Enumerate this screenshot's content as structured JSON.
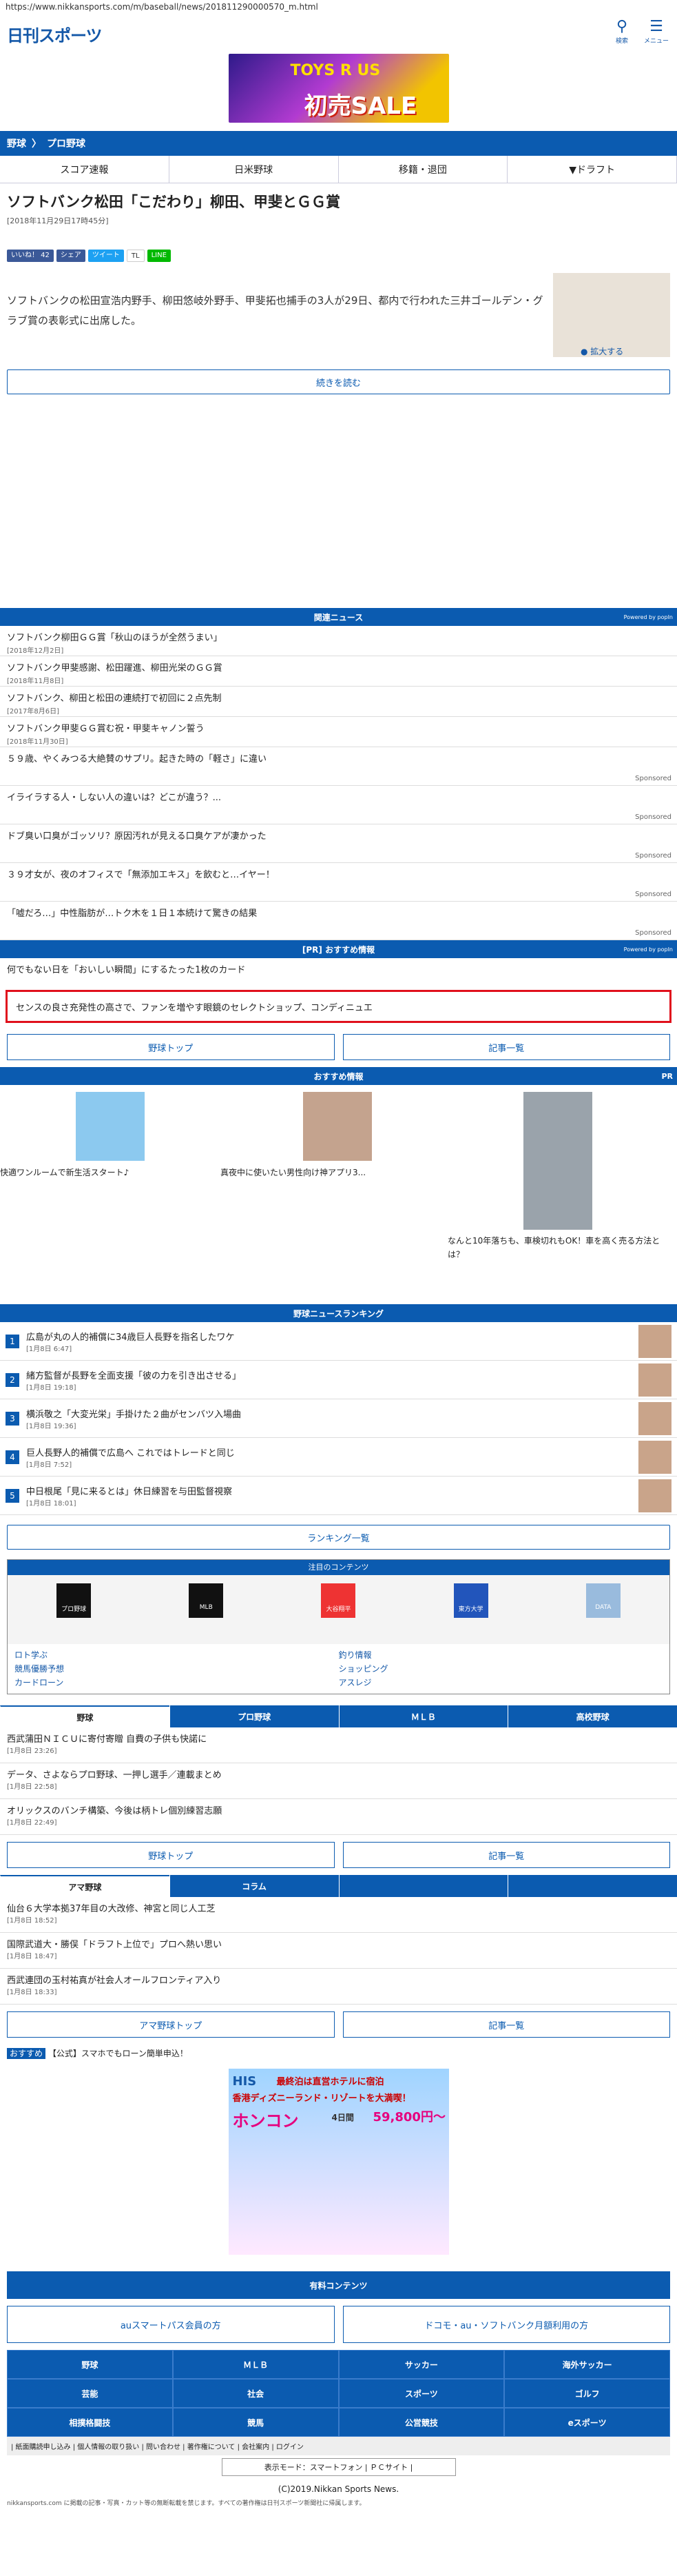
{
  "url": "https://www.nikkansports.com/m/baseball/news/201811290000570_m.html",
  "logo": "日刊スポーツ",
  "header": {
    "search": "検索",
    "menu": "メニュー"
  },
  "ad_top": {
    "line1": "TOYS R US",
    "line2": "初売SALE"
  },
  "breadcrumb": [
    "野球",
    "プロ野球"
  ],
  "subnav": [
    "スコア速報",
    "日米野球",
    "移籍・退団",
    "▼ドラフト"
  ],
  "article": {
    "title": "ソフトバンク松田「こだわり」柳田、甲斐とＧＧ賞",
    "date": "[2018年11月29日17時45分]",
    "body": "ソフトバンクの松田宣浩内野手、柳田悠岐外野手、甲斐拓也捕手の3人が29日、都内で行われた三井ゴールデン・グラブ賞の表彰式に出席した。",
    "zoom": "拡大する",
    "more": "続きを読む"
  },
  "share": [
    "いいね！ 42",
    "シェア",
    "ツイート",
    "TL",
    "LINE"
  ],
  "related": {
    "title": "関連ニュース",
    "powered": "Powered by popIn",
    "items": [
      {
        "t": "ソフトバンク柳田ＧＧ賞「秋山のほうが全然うまい」",
        "d": "[2018年12月2日]"
      },
      {
        "t": "ソフトバンク甲斐感謝、松田躍進、柳田光栄のＧＧ賞",
        "d": "[2018年11月8日]"
      },
      {
        "t": "ソフトバンク、柳田と松田の連続打で初回に２点先制",
        "d": "[2017年8月6日]"
      },
      {
        "t": "ソフトバンク甲斐ＧＧ賞む祝・甲斐キャノン誓う",
        "d": "[2018年11月30日]"
      }
    ],
    "sponsored": [
      "５９歳、やくみつる大絶賛のサプリ。起きた時の「軽さ」に違い",
      "イライラする人・しない人の違いは？どこが違う？...",
      "ドブ臭い口臭がゴッソリ？原因汚れが見える口臭ケアが凄かった",
      "３９才女が、夜のオフィスで「無添加エキス」を飲むと…イヤー！",
      "「嘘だろ…」中性脂肪が…トク木を１日１本続けて驚きの結果"
    ],
    "sponsor_label": "Sponsored"
  },
  "pr": {
    "title": "[PR] おすすめ情報",
    "items": [
      "何でもない日を「おいしい瞬間」にするたった1枚のカード",
      "センスの良さ充発性の高さで、ファンを増やす眼鏡のセレクトショップ、コンディニュエ"
    ]
  },
  "btns": {
    "top": "野球トップ",
    "list": "記事一覧",
    "ama": "アマ野球トップ",
    "rank": "ランキング一覧"
  },
  "recommend": {
    "title": "おすすめ情報",
    "pr": "PR",
    "items": [
      "快適ワンルームで新生活スタート♪",
      "真夜中に使いたい男性向け神アプリ3...",
      "なんと10年落ちも、車検切れもOK！車を高く売る方法とは？"
    ]
  },
  "ranking": {
    "title": "野球ニュースランキング",
    "items": [
      {
        "t": "広島が丸の人的補償に34歳巨人長野を指名したワケ",
        "d": "[1月8日 6:47]"
      },
      {
        "t": "緒方監督が長野を全面支援「彼の力を引き出させる」",
        "d": "[1月8日 19:18]"
      },
      {
        "t": "横浜敬之「大変光栄」手掛けた２曲がセンバツ入場曲",
        "d": "[1月8日 19:36]"
      },
      {
        "t": "巨人長野人的補償で広島へ これではトレードと同じ",
        "d": "[1月8日 7:52]"
      },
      {
        "t": "中日根尾「見に来るとは」休日練習を与田監督視察",
        "d": "[1月8日 18:01]"
      }
    ]
  },
  "contents": {
    "title": "注目のコンテンツ",
    "icons": [
      "プロ野球",
      "MLB",
      "大谷翔平",
      "東方大学",
      "DATA"
    ],
    "links": [
      "ロト学ぶ",
      "釣り情報",
      "競馬優勝予想",
      "ショッピング",
      "カードローン",
      "アスレジ"
    ]
  },
  "tabs1": [
    "野球",
    "プロ野球",
    "ＭＬＢ",
    "高校野球"
  ],
  "news1": [
    {
      "t": "西武蒲田ＮＩＣＵに寄付寄贈 自費の子供も快諾に",
      "d": "[1月8日 23:26]"
    },
    {
      "t": "データ、さよならプロ野球、一押し選手／連載まとめ",
      "d": "[1月8日 22:58]"
    },
    {
      "t": "オリックスのバンチ構築、今後は柄トレ個別練習志願",
      "d": "[1月8日 22:49]"
    }
  ],
  "tabs2": [
    "アマ野球",
    "コラム"
  ],
  "news2": [
    {
      "t": "仙台６大学本拠37年目の大改修、神宮と同じ人工芝",
      "d": "[1月8日 18:52]"
    },
    {
      "t": "国際武道大・勝俣「ドラフト上位で」プロへ熱い思い",
      "d": "[1月8日 18:47]"
    },
    {
      "t": "西武連団の玉村祐真が社会人オールフロンティア入り",
      "d": "[1月8日 18:33]"
    }
  ],
  "promo": {
    "label": "おすすめ",
    "text": "【公式】スマホでもローン簡単申込！"
  },
  "his_ad": {
    "brand": "HIS",
    "line1": "最終泊は直営ホテルに宿泊",
    "line2": "香港ディズニーランド・リゾートを大満喫！",
    "city": "ホンコン",
    "days": "4日間",
    "price": "59,800円〜"
  },
  "paid": {
    "title": "有料コンテンツ",
    "a": "auスマートパス会員の方",
    "b": "ドコモ・au・ソフトバンク月額利用の方"
  },
  "foot_nav": [
    "野球",
    "ＭＬＢ",
    "サッカー",
    "海外サッカー",
    "芸能",
    "社会",
    "スポーツ",
    "ゴルフ",
    "相撲格闘技",
    "競馬",
    "公営競技",
    "eスポーツ"
  ],
  "foot_links": "| 紙面購読申し込み | 個人情報の取り扱い | 問い合わせ | 著作権について | 会社案内 | ログイン",
  "mode": "表示モード：スマートフォン | ＰＣサイト |",
  "copyright": "(C)2019.Nikkan Sports News.",
  "notice": "nikkansports.com に掲載の記事・写真・カット等の無断転載を禁じます。すべての著作権は日刊スポーツ新聞社に帰属します。",
  "colors": {
    "brand": "#0b5bb0",
    "accent": "#e0101c"
  }
}
